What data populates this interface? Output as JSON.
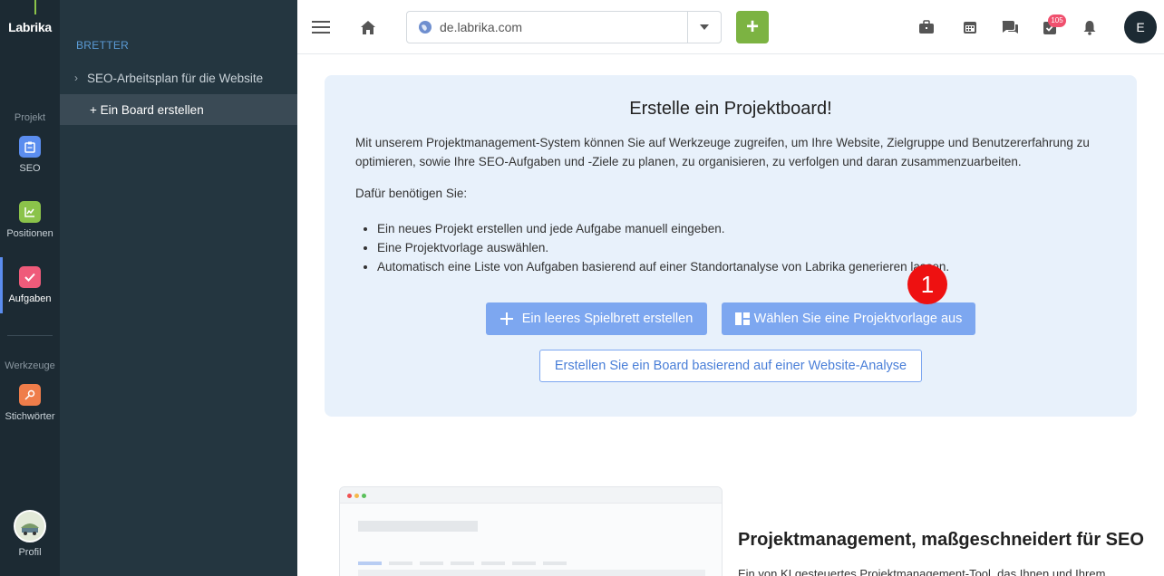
{
  "rail": {
    "logo": "Labrika",
    "projekt_label": "Projekt",
    "werkzeuge_label": "Werkzeuge",
    "items": [
      {
        "label": "SEO",
        "icon": "clipboard-icon",
        "color": "#5b8def"
      },
      {
        "label": "Positionen",
        "icon": "chart-icon",
        "color": "#8bc34a"
      },
      {
        "label": "Aufgaben",
        "icon": "check-icon",
        "color": "#ef5b7a"
      },
      {
        "label": "Stichwörter",
        "icon": "key-icon",
        "color": "#ef7d4a"
      }
    ],
    "profile": "Profil"
  },
  "sidebar": {
    "title": "BRETTER",
    "items": [
      {
        "label": "SEO-Arbeitsplan für die Website"
      },
      {
        "label": "+ Ein Board erstellen"
      }
    ]
  },
  "topbar": {
    "url": "de.labrika.com",
    "add_label": "+",
    "badge_count": "105",
    "user_initial": "E"
  },
  "card": {
    "title": "Erstelle ein Projektboard!",
    "paragraph": "Mit unserem Projektmanagement-System können Sie auf Werkzeuge zugreifen, um Ihre Website, Zielgruppe und Benutzererfahrung zu optimieren, sowie Ihre SEO-Aufgaben und -Ziele zu planen, zu organisieren, zu verfolgen und daran zusammenzuarbeiten.",
    "need": "Dafür benötigen Sie:",
    "bullets": [
      "Ein neues Projekt erstellen und jede Aufgabe manuell eingeben.",
      "Eine Projektvorlage auswählen.",
      "Automatisch eine Liste von Aufgaben basierend auf einer Standortanalyse von Labrika generieren lassen."
    ],
    "btn_empty": "Ein leeres Spielbrett erstellen",
    "btn_template": "Wählen Sie eine Projektvorlage aus",
    "btn_analysis": "Erstellen Sie ein Board basierend auf einer Website-Analyse",
    "marker": "1"
  },
  "section": {
    "title": "Projektmanagement, maßgeschneidert für SEO",
    "text": "Ein von KI gesteuertes Projektmanagement-Tool, das Ihnen und Ihrem"
  },
  "colors": {
    "accent": "#7da7f0",
    "add_green": "#7cb342",
    "badge": "#f0506e"
  }
}
